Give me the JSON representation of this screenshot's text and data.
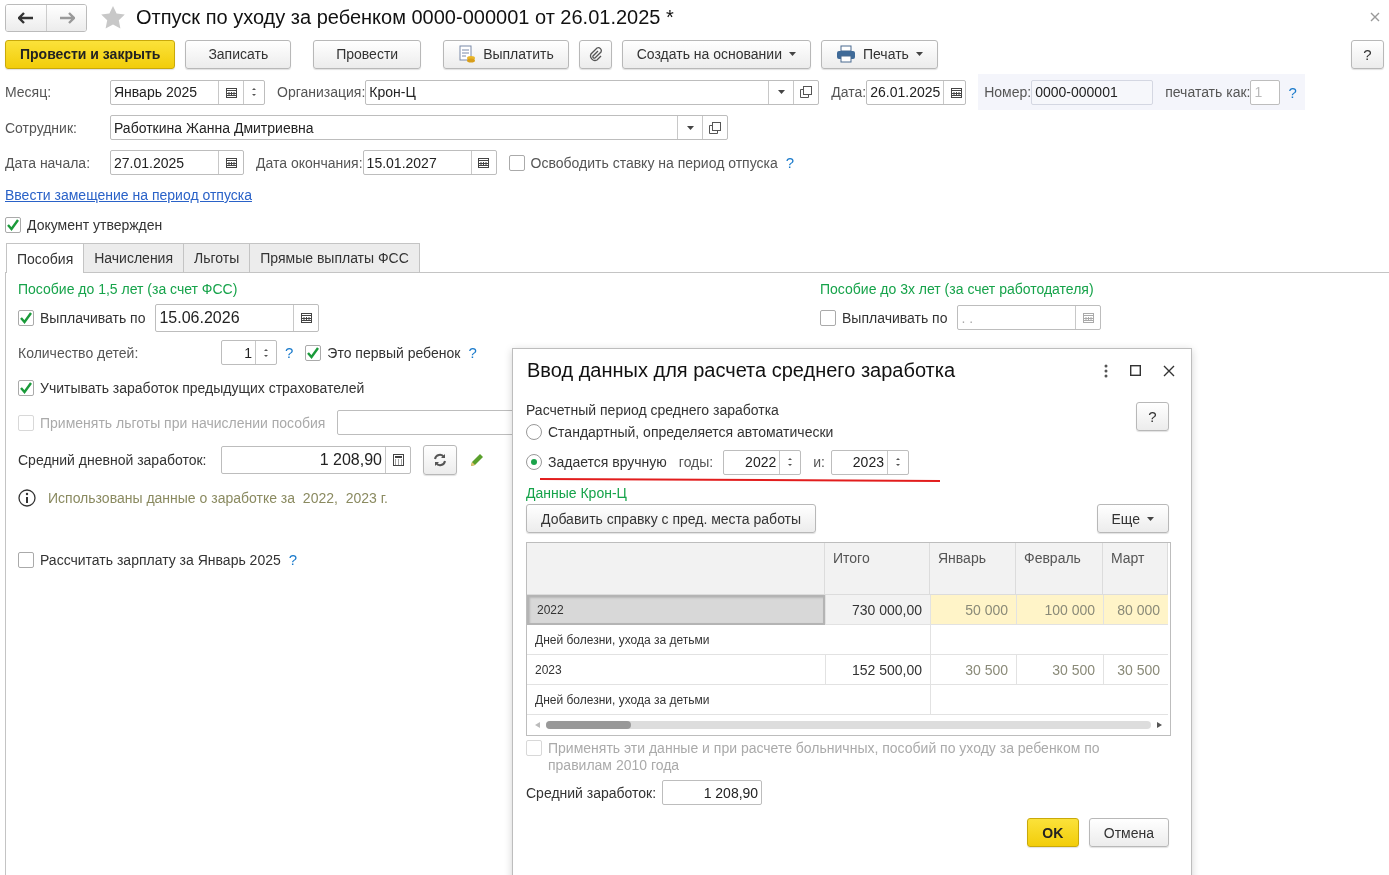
{
  "window": {
    "title": "Отпуск по уходу за ребенком 0000-000001 от 26.01.2025 *"
  },
  "toolbar": {
    "buttons": [
      {
        "label": "Провести и закрыть",
        "kind": "primary"
      },
      {
        "label": "Записать",
        "kind": "plain"
      },
      {
        "label": "Провести",
        "kind": "plain"
      },
      {
        "label": "Выплатить",
        "kind": "pay"
      },
      {
        "kind": "attach"
      },
      {
        "label": "Создать на основании",
        "kind": "dropdown"
      },
      {
        "label": "Печать",
        "kind": "print"
      }
    ],
    "help": "?"
  },
  "header": {
    "month": {
      "label": "Месяц:",
      "value": "Январь 2025"
    },
    "organization": {
      "label": "Организация:",
      "value": "Крон-Ц"
    },
    "date": {
      "label": "Дата:",
      "value": "26.01.2025"
    },
    "number": {
      "label": "Номер:",
      "value": "0000-000001"
    },
    "print_as": {
      "label": "печатать как:",
      "placeholder": "1",
      "help": "?"
    },
    "employee": {
      "label": "Сотрудник:",
      "value": "Работкина Жанна Дмитриевна"
    },
    "start_date": {
      "label": "Дата начала:",
      "value": "27.01.2025"
    },
    "end_date": {
      "label": "Дата окончания:",
      "value": "15.01.2027"
    },
    "release_rate": {
      "label": "Освободить ставку на период отпуска",
      "checked": false,
      "help": "?"
    }
  },
  "link": "Ввести замещение на период отпуска",
  "approved": {
    "label": "Документ утвержден",
    "checked": true
  },
  "tabs": [
    {
      "label": "Пособия",
      "selected": true
    },
    {
      "label": "Начисления",
      "selected": false
    },
    {
      "label": "Льготы",
      "selected": false
    },
    {
      "label": "Прямые выплаты ФСС",
      "selected": false
    }
  ],
  "benefit_15": {
    "title": "Пособие до 1,5 лет (за счет ФСС)",
    "pay_until": {
      "label": "Выплачивать по",
      "checked": true,
      "value": "15.06.2026"
    },
    "children": {
      "label": "Количество детей:",
      "value": "1",
      "help": "?"
    },
    "first_child": {
      "label": "Это первый ребенок",
      "checked": true,
      "help": "?"
    },
    "prev_insurers": {
      "label": "Учитывать заработок предыдущих страхователей",
      "checked": true
    },
    "apply_benefits": {
      "label": "Применять льготы при начислении пособия",
      "checked": false,
      "disabled": true
    },
    "avg_daily": {
      "label": "Средний дневной заработок:",
      "value": "1 208,90"
    },
    "info": "Использованы данные о заработке за  2022,  2023 г.",
    "calc_salary": {
      "label": "Рассчитать зарплату за Январь 2025",
      "checked": false,
      "help": "?"
    }
  },
  "benefit_3": {
    "title": "Пособие до 3х лет (за счет работодателя)",
    "pay_until": {
      "label": "Выплачивать по",
      "checked": false,
      "placeholder": " .  ."
    }
  },
  "dialog": {
    "title": "Ввод данных для расчета среднего заработка",
    "help": "?",
    "section_label": "Расчетный период среднего заработка",
    "period_options": [
      {
        "label": "Стандартный, определяется автоматически",
        "selected": false
      },
      {
        "label": "Задается вручную",
        "selected": true
      }
    ],
    "years_label": "годы:",
    "year_from": "2022",
    "and_label": "и:",
    "year_to": "2023",
    "org_title": "Данные Крон-Ц",
    "add_button": "Добавить справку с пред. места работы",
    "more_button": "Еще",
    "table": {
      "columns": [
        "",
        "Итого",
        "Январь",
        "Февраль",
        "Март"
      ],
      "rows": [
        {
          "kind": "year",
          "selected": true,
          "cells": [
            "2022",
            "730 000,00",
            "50 000",
            "100 000",
            "80 000"
          ]
        },
        {
          "kind": "note",
          "cells": [
            "Дней болезни, ухода за детьми"
          ]
        },
        {
          "kind": "year",
          "selected": false,
          "cells": [
            "2023",
            "152 500,00",
            "30 500",
            "30 500",
            "30 500"
          ]
        },
        {
          "kind": "note",
          "cells": [
            "Дней болезни, ухода за детьми"
          ]
        }
      ]
    },
    "apply_2010": {
      "label": "Применять эти данные и при расчете больничных, пособий по уходу за ребенком по правилам 2010 года",
      "checked": false,
      "disabled": true
    },
    "average": {
      "label": "Средний заработок:",
      "value": "1 208,90"
    },
    "ok": "OK",
    "cancel": "Отмена"
  }
}
